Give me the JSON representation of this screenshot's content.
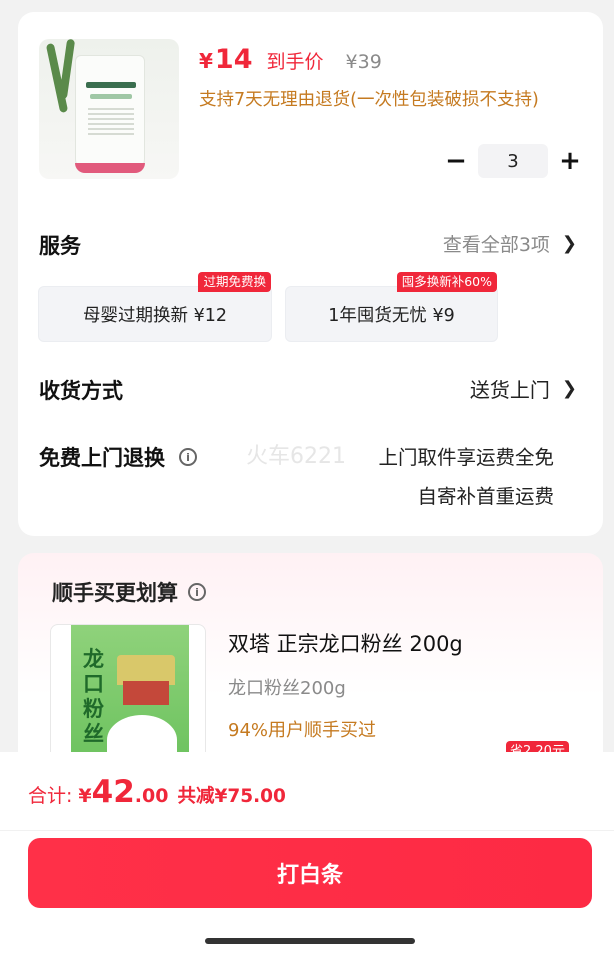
{
  "product": {
    "yen": "¥",
    "price": "14",
    "price_tag": "到手价",
    "original_price": "¥39",
    "return_note": "支持7天无理由退货(一次性包装破损不支持)",
    "quantity": "3",
    "image_icon": "laundry-liquid-image"
  },
  "service": {
    "title": "服务",
    "view_all": "查看全部3项",
    "items": [
      {
        "badge": "过期免费换",
        "label": "母婴过期换新  ¥12"
      },
      {
        "badge": "囤多换新补60%",
        "label": "1年囤货无忧  ¥9"
      }
    ]
  },
  "delivery": {
    "title": "收货方式",
    "value": "送货上门"
  },
  "free_return": {
    "title": "免费上门退换",
    "watermark": "火车6221",
    "line1": "上门取件享运费全免",
    "line2": "自寄补首重运费"
  },
  "addon": {
    "title": "顺手买更划算",
    "name": "双塔 正宗龙口粉丝 200g",
    "spec": "龙口粉丝200g",
    "percent": "94%用户顺手买过",
    "save": "省2.20元",
    "package_chars": "龙口粉丝"
  },
  "footer": {
    "total_label": "合计:",
    "total_yen": "¥",
    "total_int": "42",
    "total_dec": ".00",
    "total_save": "共减¥75.00",
    "pay_button": "打白条"
  },
  "colors": {
    "accent": "#f0273a",
    "orange_note": "#c57a20",
    "muted": "#8a8a8a"
  }
}
